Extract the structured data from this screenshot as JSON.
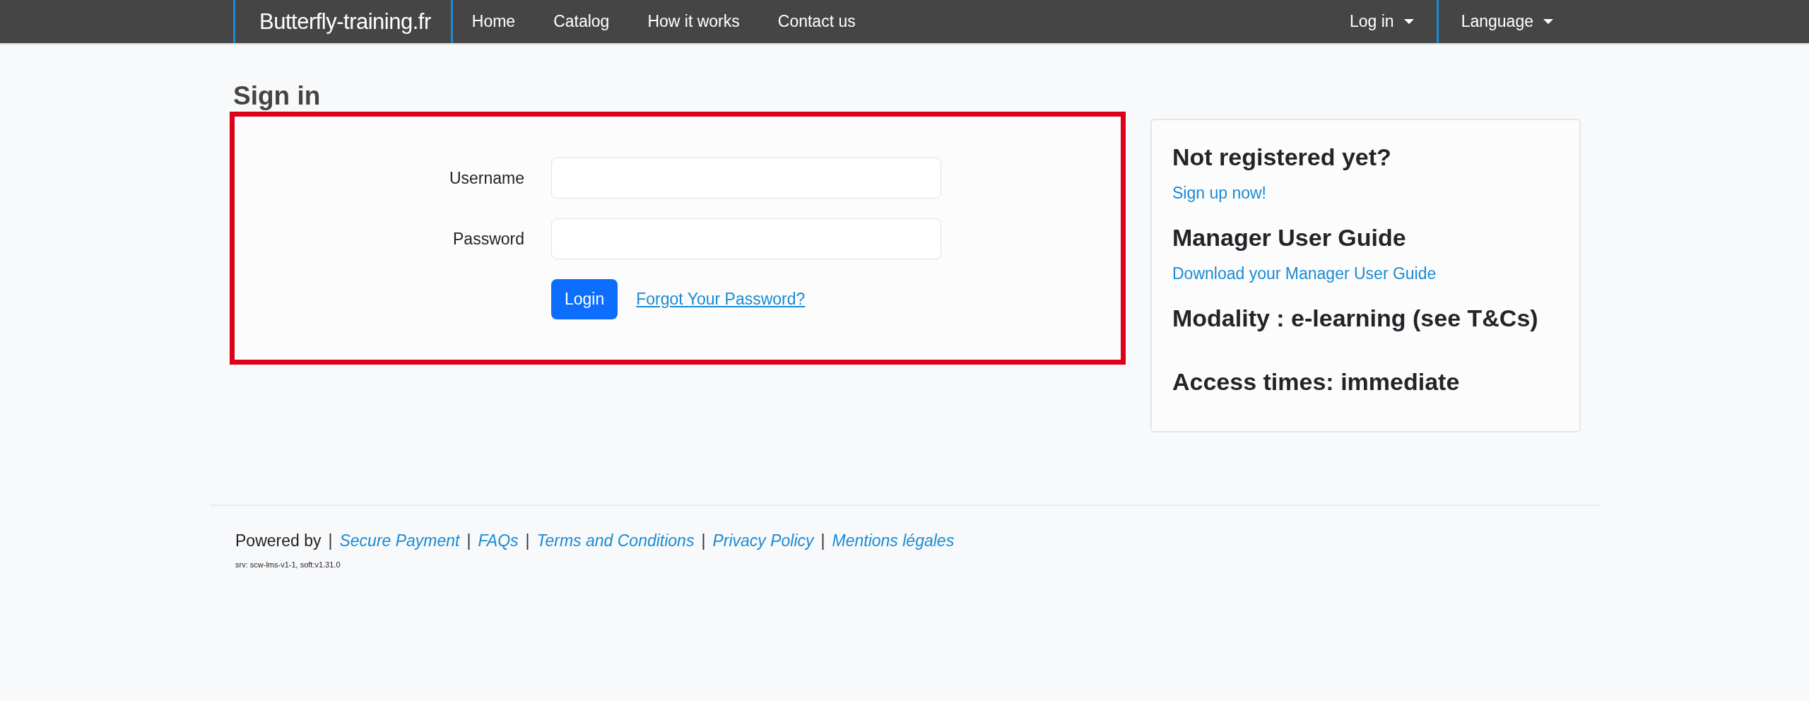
{
  "navbar": {
    "brand": "Butterfly-training.fr",
    "links": [
      {
        "label": "Home"
      },
      {
        "label": "Catalog"
      },
      {
        "label": "How it works"
      },
      {
        "label": "Contact us"
      }
    ],
    "dropdowns": [
      {
        "label": "Log in"
      },
      {
        "label": "Language"
      }
    ]
  },
  "page_title": "Sign in",
  "login_form": {
    "fields": [
      {
        "label": "Username"
      },
      {
        "label": "Password"
      }
    ],
    "submit": "Login",
    "forgot_link": "Forgot Your Password?"
  },
  "side_panel": [
    {
      "kind": "heading",
      "text": "Not registered yet?"
    },
    {
      "kind": "link",
      "text": "Sign up now!"
    },
    {
      "kind": "heading",
      "text": "Manager User Guide"
    },
    {
      "kind": "link",
      "text": "Download your Manager User Guide"
    },
    {
      "kind": "heading",
      "text": "Modality : e-learning (see T&Cs)"
    },
    {
      "kind": "heading",
      "text": "Access times: immediate"
    }
  ],
  "footer": {
    "items": [
      {
        "kind": "text",
        "text": "Powered by"
      },
      {
        "kind": "separator",
        "text": "|"
      },
      {
        "kind": "link",
        "text": "Secure Payment"
      },
      {
        "kind": "separator",
        "text": "|"
      },
      {
        "kind": "link",
        "text": "FAQs"
      },
      {
        "kind": "separator",
        "text": "|"
      },
      {
        "kind": "link",
        "text": "Terms and Conditions"
      },
      {
        "kind": "separator",
        "text": "|"
      },
      {
        "kind": "link",
        "text": "Privacy Policy"
      },
      {
        "kind": "separator",
        "text": "|"
      },
      {
        "kind": "link",
        "text": "Mentions légales"
      }
    ],
    "version": "srv: scw-lms-v1-1, soft:v1.31.0"
  }
}
